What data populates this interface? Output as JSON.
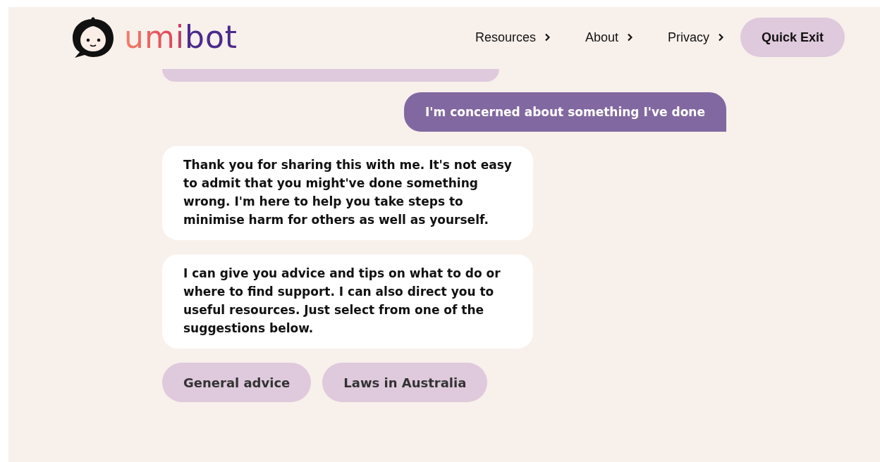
{
  "header": {
    "logo": "umibot",
    "nav": [
      {
        "label": "Resources"
      },
      {
        "label": "About"
      },
      {
        "label": "Privacy"
      }
    ],
    "quick_exit": "Quick Exit"
  },
  "messages": [
    {
      "kind": "partial"
    },
    {
      "kind": "user",
      "text": "I'm concerned about something I've done"
    },
    {
      "kind": "bot",
      "text": "Thank you for sharing this with me. It's not easy to admit that you might've done something wrong. I'm here to help you take steps to minimise harm for others as well as yourself."
    },
    {
      "kind": "bot",
      "text": "I can give you advice and tips on what to do or where to find support. I can also direct you to useful resources. Just select from one of the suggestions below."
    }
  ],
  "suggestions": [
    "General advice",
    "Laws in Australia"
  ]
}
